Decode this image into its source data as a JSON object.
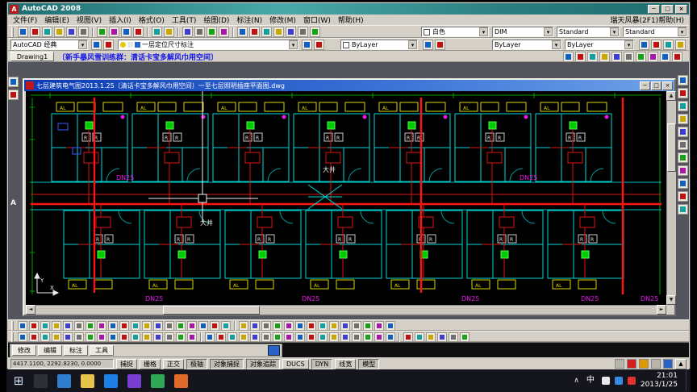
{
  "app": {
    "title": "AutoCAD 2008",
    "buttons": {
      "min": "─",
      "max": "□",
      "close": "×"
    }
  },
  "glyphs": {
    "menu_arrow": "▾",
    "up": "▲",
    "down": "▼",
    "left": "◄",
    "right": "►",
    "start": "⊞",
    "tray_up": "∧"
  },
  "menu": {
    "items": [
      "文件(F)",
      "编辑(E)",
      "视图(V)",
      "插入(I)",
      "格式(O)",
      "工具(T)",
      "绘图(D)",
      "标注(N)",
      "修改(M)",
      "窗口(W)",
      "帮助(H)"
    ],
    "right_text": "瑞天风暴(2F1)帮助(H)"
  },
  "toolbar1": {
    "color_value": "白色",
    "dimstyle_value": "DIM",
    "textstyle_value": "Standard",
    "tablestyle_value": "Standard"
  },
  "toolbar2": {
    "workspace_value": "AutoCAD 经典",
    "layer_value": "一层定位尺寸标注",
    "color_bylayer": "ByLayer",
    "linetype_bylayer": "ByLayer",
    "lineweight_bylayer": "ByLayer"
  },
  "tabs": {
    "drawing_tab": "Drawing1",
    "notice": "〔新手暴风雪训练群：清话卡宝多解风巾用空间〕"
  },
  "mdi": {
    "title": "七层建筑电气图2013.1.25〔清话卡宝多解风巾用空间〕一至七层照明插座平面图.dwg"
  },
  "plan": {
    "al": "AL",
    "r": "R",
    "shaft_top": "大井",
    "shaft_bottom": "大井",
    "ucs_x": "X",
    "ucs_y": "Y",
    "dn": [
      "DN25",
      "DN25",
      "DN25",
      "DN25",
      "DN25",
      "DN25",
      "DN25"
    ]
  },
  "sidedock": {
    "a": "A"
  },
  "cmdpanel": {
    "buttons": [
      "修改",
      "编辑",
      "标注",
      "工具"
    ]
  },
  "status": {
    "coords": "4417.1100, 2292.8230, 0.0000",
    "toggles": [
      "捕捉",
      "栅格",
      "正交",
      "极轴",
      "对象捕捉",
      "对象追踪",
      "DUCS",
      "DYN",
      "线宽",
      "模型"
    ]
  },
  "taskbar": {
    "ime": "中",
    "time": "21:01",
    "date": "2013/1/25"
  }
}
